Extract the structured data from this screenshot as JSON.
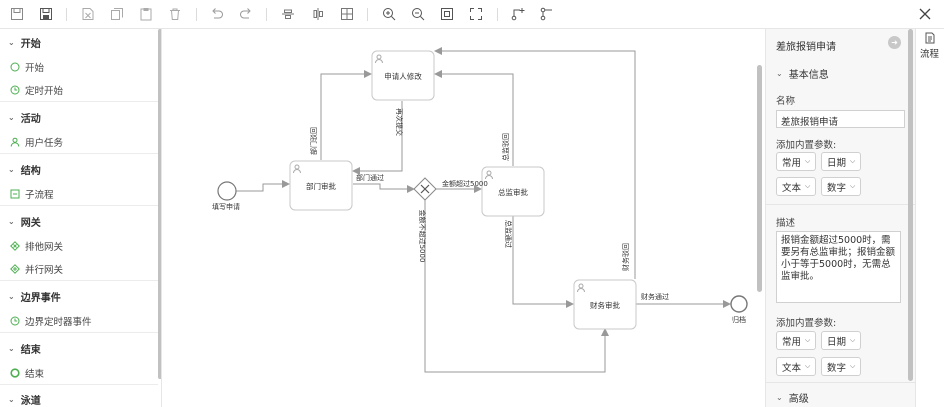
{
  "toolbar": {
    "icons": [
      "save-icon",
      "save-as-icon",
      "delete-doc-icon",
      "copy-icon",
      "paste-icon",
      "trash-icon",
      "undo-icon",
      "redo-icon",
      "align-top-icon",
      "align-middle-icon",
      "distribute-icon",
      "zoom-in-icon",
      "zoom-out-icon",
      "fit-icon",
      "actual-size-icon",
      "add-node-icon",
      "flow-icon",
      "close-icon"
    ]
  },
  "palette": {
    "groups": [
      {
        "title": "开始",
        "items": [
          {
            "label": "开始",
            "icon": "circle-icon"
          },
          {
            "label": "定时开始",
            "icon": "clock-icon"
          }
        ]
      },
      {
        "title": "活动",
        "items": [
          {
            "label": "用户任务",
            "icon": "user-icon"
          }
        ]
      },
      {
        "title": "结构",
        "items": [
          {
            "label": "子流程",
            "icon": "subprocess-icon"
          }
        ]
      },
      {
        "title": "网关",
        "items": [
          {
            "label": "排他网关",
            "icon": "diamond-icon"
          },
          {
            "label": "并行网关",
            "icon": "diamond-plus-icon"
          }
        ]
      },
      {
        "title": "边界事件",
        "items": [
          {
            "label": "边界定时器事件",
            "icon": "clock-icon"
          }
        ]
      },
      {
        "title": "结束",
        "items": [
          {
            "label": "结束",
            "icon": "circle-bold-icon"
          }
        ]
      },
      {
        "title": "泳道",
        "items": []
      }
    ]
  },
  "diagram": {
    "start_label": "填写申请",
    "end_label": "归档",
    "tasks": {
      "modify": "申请人修改",
      "dept": "部门审批",
      "director": "总监审批",
      "finance": "财务审批"
    },
    "flows": {
      "dept_reject": "部门驳回",
      "resubmit": "再次提交",
      "dept_pass": "部门通过",
      "amount_over": "金额超过5000",
      "amount_not_over": "金额不超过5000",
      "director_reject": "总监驳回",
      "director_pass": "总监通过",
      "finance_reject": "财务驳回",
      "finance_pass": "财务通过"
    }
  },
  "panel": {
    "title": "差旅报销申请",
    "basic_section": "基本信息",
    "name_label": "名称",
    "name_value": "差旅报销申请",
    "builtin_params_label": "添加内置参数:",
    "select_common": "常用",
    "select_date": "日期",
    "select_text": "文本",
    "select_number": "数字",
    "desc_label": "描述",
    "desc_value": "报销金额超过5000时，需要另有总监审批；报销金额小于等于5000时，无需总监审批。",
    "builtin_params_label2": "添加内置参数:",
    "advanced_section": "高级"
  },
  "side_tab": {
    "label": "流程"
  },
  "colors": {
    "line": "#999999",
    "node_border": "#cccccc",
    "accent_green": "#4caf50"
  }
}
